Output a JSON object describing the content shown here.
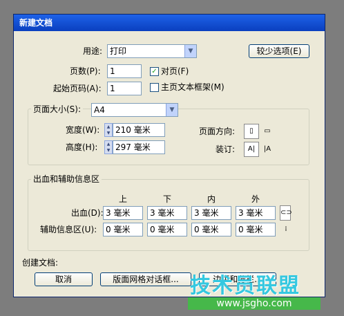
{
  "dialog": {
    "title": "新建文档"
  },
  "purpose": {
    "label": "用途:",
    "value": "打印"
  },
  "fewer_options_button": "较少选项(E)",
  "pages": {
    "label": "页数(P):",
    "value": "1"
  },
  "facing_pages": {
    "label": "对页(F)",
    "checked": true
  },
  "start_page": {
    "label": "起始页码(A):",
    "value": "1"
  },
  "master_text_frame": {
    "label": "主页文本框架(M)",
    "checked": false
  },
  "page_size_group": {
    "label": "页面大小(S):",
    "value": "A4",
    "width_label": "宽度(W):",
    "width_value": "210 毫米",
    "height_label": "高度(H):",
    "height_value": "297 毫米",
    "orientation_label": "页面方向:",
    "binding_label": "装订:"
  },
  "bleed_slug_group": {
    "title": "出血和辅助信息区",
    "columns": [
      "上",
      "下",
      "内",
      "外"
    ],
    "bleed_label": "出血(D):",
    "bleed_values": [
      "3 毫米",
      "3 毫米",
      "3 毫米",
      "3 毫米"
    ],
    "slug_label": "辅助信息区(U):",
    "slug_values": [
      "0 毫米",
      "0 毫米",
      "0 毫米",
      "0 毫米"
    ]
  },
  "create_document_label": "创建文档:",
  "buttons": {
    "cancel": "取消",
    "layout_grid": "版面网格对话框...",
    "margins": "边距和分栏..."
  },
  "watermark": {
    "title": "技术员联盟",
    "url": "www.jsgho.com"
  },
  "colors": {
    "title_bar": "#0a3fbf",
    "dialog_bg": "#ece9d8",
    "watermark_blue": "#35c8e0",
    "watermark_green": "#46b84a"
  }
}
